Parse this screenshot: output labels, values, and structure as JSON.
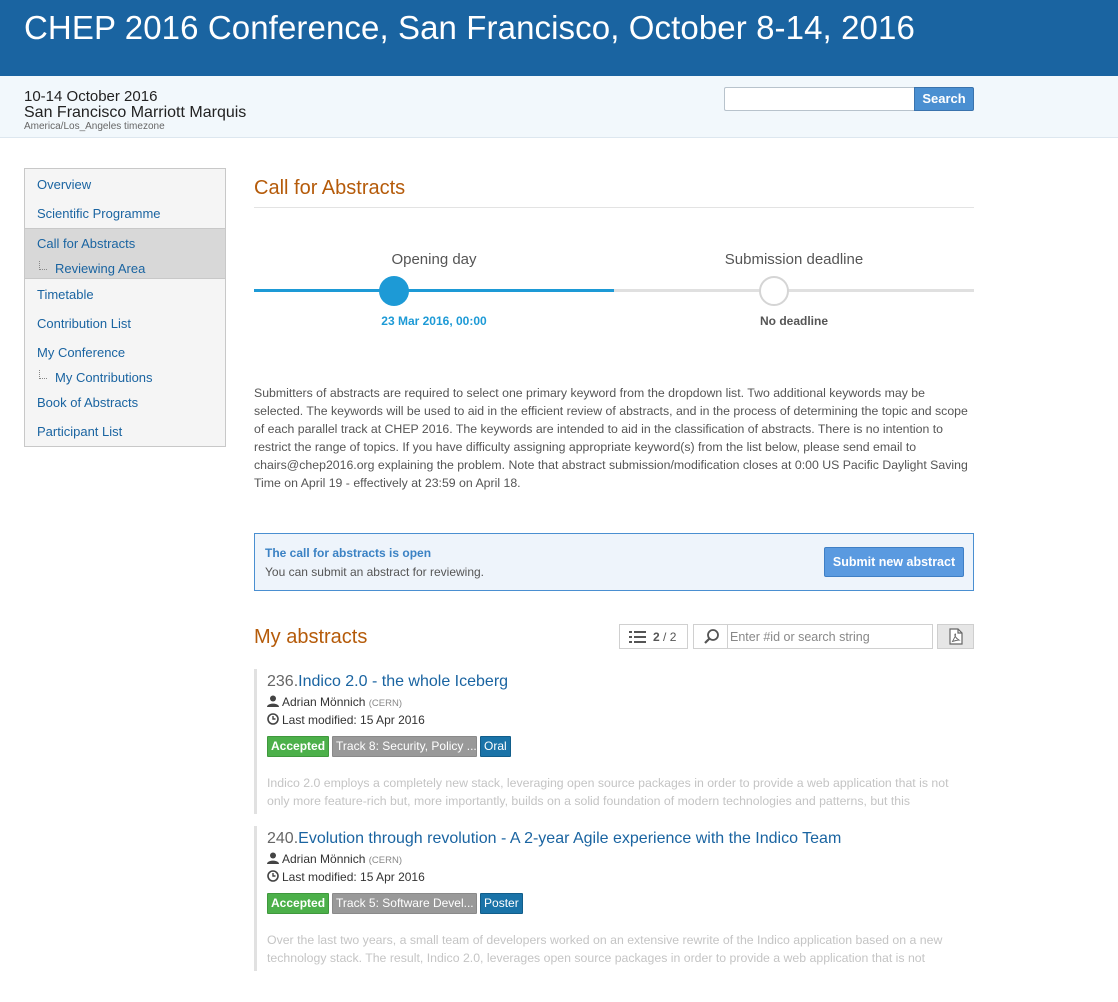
{
  "header": {
    "title": "CHEP 2016 Conference, San Francisco, October 8-14, 2016"
  },
  "event": {
    "dates": "10-14 October 2016",
    "venue": "San Francisco Marriott Marquis",
    "timezone": "America/Los_Angeles timezone"
  },
  "search": {
    "button": "Search",
    "placeholder": ""
  },
  "menu": [
    {
      "label": "Overview"
    },
    {
      "label": "Scientific Programme"
    },
    {
      "label": "Call for Abstracts"
    },
    {
      "label": "Reviewing Area"
    },
    {
      "label": "Timetable"
    },
    {
      "label": "Contribution List"
    },
    {
      "label": "My Conference"
    },
    {
      "label": "My Contributions"
    },
    {
      "label": "Book of Abstracts"
    },
    {
      "label": "Participant List"
    }
  ],
  "page": {
    "title": "Call for Abstracts"
  },
  "timeline": {
    "opening_label": "Opening day",
    "opening_date": "23 Mar 2016, 00:00",
    "deadline_label": "Submission deadline",
    "deadline_date": "No deadline",
    "done_color": "#1d9ad6"
  },
  "description": "Submitters of abstracts are required to select one primary keyword from the dropdown list. Two additional keywords may be selected. The keywords will be used to aid in the efficient review of abstracts, and in the process of determining the topic and scope of each parallel track at CHEP 2016. The keywords are intended to aid in the classification of abstracts. There is no intention to restrict the range of topics. If you have difficulty assigning appropriate keyword(s) from the list below, please send email to chairs@chep2016.org explaining the problem. Note that abstract submission/modification closes at 0:00 US Pacific Daylight Saving Time on April 19 - effectively at 23:59 on April 18.",
  "cfa": {
    "status_title": "The call for abstracts is open",
    "status_text": "You can submit an abstract for reviewing.",
    "submit_label": "Submit new abstract"
  },
  "my_abstracts": {
    "title": "My abstracts",
    "count_shown": "2",
    "count_total": "/ 2",
    "search_placeholder": "Enter #id or search string",
    "items": [
      {
        "number": "236.",
        "title": "Indico 2.0 - the whole Iceberg",
        "author": "Adrian Mönnich",
        "affiliation": "(CERN)",
        "modified": "Last modified: 15 Apr 2016",
        "status": "Accepted",
        "track": "Track 8: Security, Policy ...",
        "type": "Oral",
        "excerpt": "Indico 2.0 employs a completely new stack, leveraging open source packages in order to provide a web application that is not only more feature-rich but, more importantly, builds on a solid foundation of modern technologies and patterns, but this"
      },
      {
        "number": "240.",
        "title": "Evolution through revolution - A 2-year Agile experience with the Indico Team",
        "author": "Adrian Mönnich",
        "affiliation": "(CERN)",
        "modified": "Last modified: 15 Apr 2016",
        "status": "Accepted",
        "track": "Track 5: Software Devel...",
        "type": "Poster",
        "excerpt": "Over the last two years, a small team of developers worked on an extensive rewrite of the Indico application based on a new technology stack. The result, Indico 2.0, leverages open source packages in order to provide a web application that is not"
      }
    ]
  },
  "icons": {
    "user": "user-icon",
    "clock": "clock-icon",
    "list": "list-icon",
    "search": "search-icon",
    "pdf": "pdf-icon"
  }
}
